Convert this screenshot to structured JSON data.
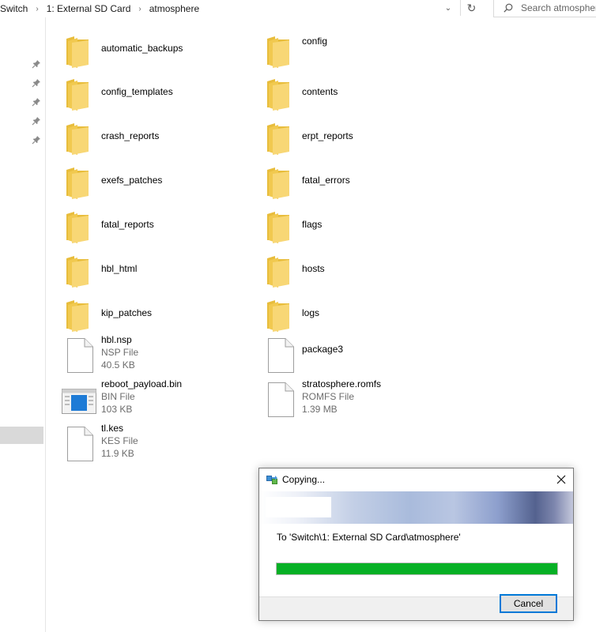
{
  "address": {
    "segments": [
      "Switch",
      "1: External SD Card",
      "atmosphere"
    ],
    "separator": "›",
    "dropdown_glyph": "⌄",
    "refresh_glyph": "↻"
  },
  "search": {
    "placeholder": "Search atmosphere"
  },
  "files": [
    {
      "name": "automatic_backups",
      "type": "folder"
    },
    {
      "name": "config",
      "type": "folder"
    },
    {
      "name": "config_templates",
      "type": "folder"
    },
    {
      "name": "contents",
      "type": "folder"
    },
    {
      "name": "crash_reports",
      "type": "folder"
    },
    {
      "name": "erpt_reports",
      "type": "folder"
    },
    {
      "name": "exefs_patches",
      "type": "folder"
    },
    {
      "name": "fatal_errors",
      "type": "folder"
    },
    {
      "name": "fatal_reports",
      "type": "folder"
    },
    {
      "name": "flags",
      "type": "folder"
    },
    {
      "name": "hbl_html",
      "type": "folder"
    },
    {
      "name": "hosts",
      "type": "folder"
    },
    {
      "name": "kip_patches",
      "type": "folder"
    },
    {
      "name": "logs",
      "type": "folder"
    },
    {
      "name": "hbl.nsp",
      "type": "file",
      "kind": "NSP File",
      "size": "40.5 KB"
    },
    {
      "name": "package3",
      "type": "file"
    },
    {
      "name": "reboot_payload.bin",
      "type": "app",
      "kind": "BIN File",
      "size": "103 KB"
    },
    {
      "name": "stratosphere.romfs",
      "type": "file",
      "kind": "ROMFS File",
      "size": "1.39 MB"
    },
    {
      "name": "tl.kes",
      "type": "file",
      "kind": "KES File",
      "size": "11.9 KB"
    }
  ],
  "dialog": {
    "title": "Copying...",
    "destination_text": "To 'Switch\\1: External SD Card\\atmosphere'",
    "progress": 1.0,
    "cancel_label": "Cancel"
  },
  "colors": {
    "folder": "#f6d46a",
    "progress": "#06b025",
    "button_focus": "#0078d7"
  },
  "icons": {
    "pin": "pin-icon",
    "search": "search-icon",
    "close": "close-icon",
    "copy": "copy-icon"
  }
}
